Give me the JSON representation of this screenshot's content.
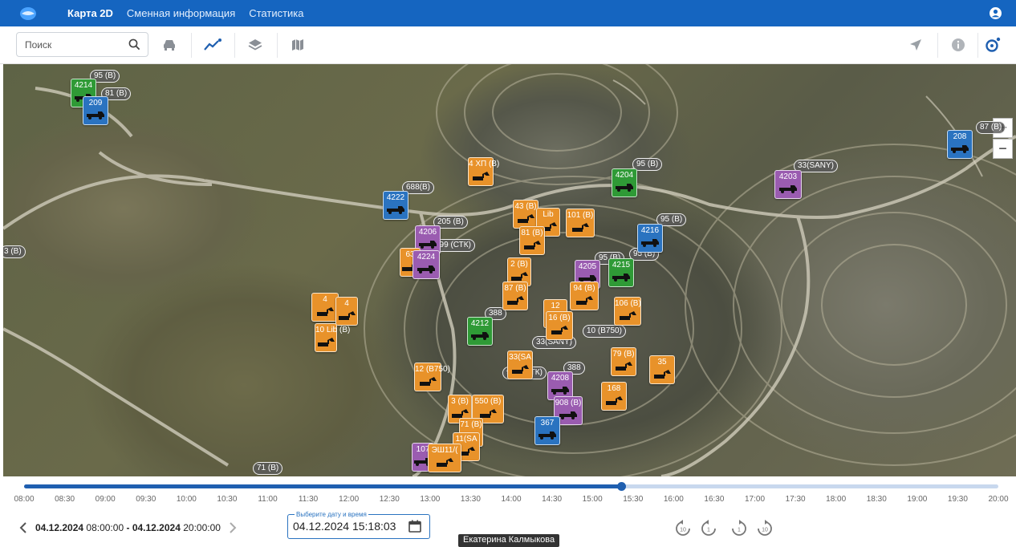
{
  "nav": {
    "items": [
      {
        "label": "Карта 2D",
        "active": true
      },
      {
        "label": "Сменная информация",
        "active": false
      },
      {
        "label": "Статистика",
        "active": false
      }
    ]
  },
  "toolbar": {
    "search_placeholder": "Поиск",
    "buttons": [
      "car-icon",
      "trend-icon",
      "layers-icon",
      "map-icon",
      "navigation-icon",
      "info-icon",
      "refresh-icon"
    ]
  },
  "map": {
    "zoom_in": "+",
    "zoom_out": "−",
    "markers": [
      {
        "id": "m1",
        "label": "4214",
        "color": "green"
      },
      {
        "id": "m2",
        "label": "209",
        "color": "blue"
      },
      {
        "id": "m3",
        "label": "208",
        "color": "blue"
      },
      {
        "id": "m4",
        "label": "4204",
        "color": "green"
      },
      {
        "id": "m5",
        "label": "4203",
        "color": "purple"
      },
      {
        "id": "m6",
        "label": "4222",
        "color": "blue"
      },
      {
        "id": "m7",
        "label": "4206",
        "color": "purple"
      },
      {
        "id": "m8",
        "label": "4224",
        "color": "purple"
      },
      {
        "id": "m9",
        "label": "4 ХП (В)",
        "color": "orange"
      },
      {
        "id": "m10",
        "label": "43 (В)",
        "color": "orange"
      },
      {
        "id": "m11",
        "label": "Lib",
        "color": "orange"
      },
      {
        "id": "m12",
        "label": "101 (В)",
        "color": "orange"
      },
      {
        "id": "m13",
        "label": "81 (В)",
        "color": "orange"
      },
      {
        "id": "m14",
        "label": "4216",
        "color": "blue"
      },
      {
        "id": "m15",
        "label": "4205",
        "color": "purple"
      },
      {
        "id": "m16",
        "label": "4215",
        "color": "green"
      },
      {
        "id": "m17",
        "label": "2 (В)",
        "color": "orange"
      },
      {
        "id": "m18",
        "label": "87 (В)",
        "color": "orange"
      },
      {
        "id": "m19",
        "label": "94 (В)",
        "color": "orange"
      },
      {
        "id": "m20",
        "label": "106 (В)",
        "color": "orange"
      },
      {
        "id": "m21",
        "label": "12",
        "color": "orange"
      },
      {
        "id": "m22",
        "label": "16 (В)",
        "color": "orange"
      },
      {
        "id": "m23",
        "label": "4212",
        "color": "green"
      },
      {
        "id": "m24",
        "label": "79 (В)",
        "color": "orange"
      },
      {
        "id": "m25",
        "label": "35",
        "color": "orange"
      },
      {
        "id": "m26",
        "label": "12 (В750)",
        "color": "orange"
      },
      {
        "id": "m27",
        "label": "33(SA",
        "color": "orange"
      },
      {
        "id": "m28",
        "label": "4208",
        "color": "purple"
      },
      {
        "id": "m29",
        "label": "168",
        "color": "orange"
      },
      {
        "id": "m30",
        "label": "908 (В)",
        "color": "purple"
      },
      {
        "id": "m31",
        "label": "3 (В)",
        "color": "orange"
      },
      {
        "id": "m32",
        "label": "550 (В)",
        "color": "orange"
      },
      {
        "id": "m33",
        "label": "367",
        "color": "blue"
      },
      {
        "id": "m34",
        "label": "71 (В)",
        "color": "orange"
      },
      {
        "id": "m35",
        "label": "11(SA",
        "color": "orange"
      },
      {
        "id": "m36",
        "label": "107",
        "color": "purple"
      },
      {
        "id": "m37",
        "label": "ЭШ11/(",
        "color": "orange"
      },
      {
        "id": "m38",
        "label": "10 Lib (В)",
        "color": "orange"
      },
      {
        "id": "m39",
        "label": "4",
        "color": "orange"
      },
      {
        "id": "m40",
        "label": "4",
        "color": "orange"
      },
      {
        "id": "m41",
        "label": "63",
        "color": "orange"
      }
    ],
    "pills": [
      {
        "id": "p1",
        "label": "95 (В)"
      },
      {
        "id": "p2",
        "label": "81 (В)"
      },
      {
        "id": "p3",
        "label": "87 (В)"
      },
      {
        "id": "p4",
        "label": "95 (В)"
      },
      {
        "id": "p5",
        "label": "33(SANY)"
      },
      {
        "id": "p6",
        "label": "688(В)"
      },
      {
        "id": "p7",
        "label": "205 (В)"
      },
      {
        "id": "p8",
        "label": "999 (СТК)"
      },
      {
        "id": "p9",
        "label": "95 (В)"
      },
      {
        "id": "p10",
        "label": "95 (В)"
      },
      {
        "id": "p11",
        "label": "95 (В)"
      },
      {
        "id": "p12",
        "label": "388"
      },
      {
        "id": "p13",
        "label": "10 (В750)"
      },
      {
        "id": "p14",
        "label": "33(SANY)"
      },
      {
        "id": "p15",
        "label": "388"
      },
      {
        "id": "p16",
        "label": "999 (СТК)"
      },
      {
        "id": "p17",
        "label": "71 (В)"
      },
      {
        "id": "p18",
        "label": "3 (В)"
      },
      {
        "id": "p19",
        "label": "95"
      }
    ]
  },
  "timeline": {
    "ticks": [
      "08:00",
      "08:30",
      "09:00",
      "09:30",
      "10:00",
      "10:30",
      "11:00",
      "11:30",
      "12:00",
      "12:30",
      "13:00",
      "13:30",
      "14:00",
      "14:30",
      "15:00",
      "15:30",
      "16:00",
      "16:30",
      "17:00",
      "17:30",
      "18:00",
      "18:30",
      "19:00",
      "19:30",
      "20:00"
    ],
    "progress": 0.613,
    "range_start_date": "04.12.2024",
    "range_start_time": "08:00:00",
    "range_sep": "-",
    "range_end_date": "04.12.2024",
    "range_end_time": "20:00:00",
    "datetime_label": "Выберите дату и время",
    "datetime_value": "04.12.2024 15:18:03",
    "tooltip": "Екатерина Калмыкова",
    "playback_buttons": [
      "rewind-10-icon",
      "rewind-icon",
      "forward-icon",
      "forward-10-icon"
    ]
  },
  "colors": {
    "header": "#1565c0",
    "accent": "#1f5fb0",
    "orange": "#e8922a",
    "blue": "#2a73c0",
    "green": "#2f9a36",
    "purple": "#9a5cb0"
  }
}
